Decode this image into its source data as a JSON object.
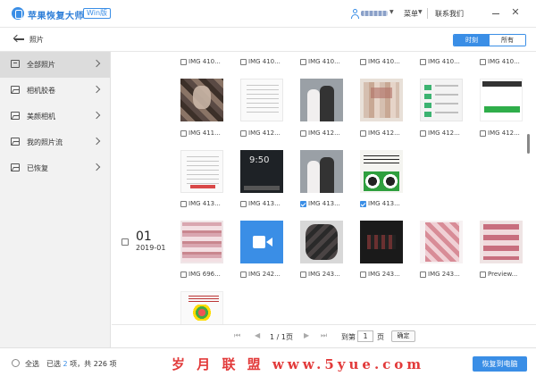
{
  "app": {
    "title": "苹果恢复大师",
    "edition": "Win版",
    "menu_label": "菜单",
    "contact_label": "联系我们",
    "minimize_icon": "minimize-icon",
    "close_icon": "close-icon",
    "accent_color": "#3a8ee6"
  },
  "subheader": {
    "section_title": "照片",
    "tabs": [
      {
        "label": "时刻",
        "active": true
      },
      {
        "label": "所有",
        "active": false
      }
    ]
  },
  "sidebar": {
    "items": [
      {
        "label": "全部照片",
        "active": true
      },
      {
        "label": "相机胶卷",
        "active": false
      },
      {
        "label": "美颜相机",
        "active": false
      },
      {
        "label": "我的照片流",
        "active": false
      },
      {
        "label": "已恢复",
        "active": false
      }
    ]
  },
  "grid": {
    "row0": [
      {
        "name": "IMG 410...",
        "checked": false
      },
      {
        "name": "IMG 410...",
        "checked": false
      },
      {
        "name": "IMG 410...",
        "checked": false
      },
      {
        "name": "IMG 410...",
        "checked": false
      },
      {
        "name": "IMG 410...",
        "checked": false
      },
      {
        "name": "IMG 410...",
        "checked": false
      }
    ],
    "row1": [
      {
        "name": "IMG 411...",
        "checked": false
      },
      {
        "name": "IMG 412...",
        "checked": false
      },
      {
        "name": "IMG 412...",
        "checked": false
      },
      {
        "name": "IMG 412...",
        "checked": false
      },
      {
        "name": "IMG 412...",
        "checked": false
      },
      {
        "name": "IMG 412...",
        "checked": false
      }
    ],
    "row2": [
      {
        "name": "IMG 413...",
        "checked": false
      },
      {
        "name": "IMG 413...",
        "checked": false
      },
      {
        "name": "IMG 413...",
        "checked": true
      },
      {
        "name": "IMG 413...",
        "checked": true
      }
    ],
    "date_group": {
      "day": "01",
      "date": "2019-01"
    },
    "row3": [
      {
        "name": "IMG 696...",
        "checked": false
      },
      {
        "name": "IMG 242...",
        "checked": false
      },
      {
        "name": "IMG 243...",
        "checked": false
      },
      {
        "name": "IMG 243...",
        "checked": false
      },
      {
        "name": "IMG 243...",
        "checked": false
      },
      {
        "name": "Preview...",
        "checked": false
      }
    ]
  },
  "pagination": {
    "current": "1 / 1页",
    "goto_label": "到第",
    "page_value": "1",
    "page_suffix": "页",
    "confirm_label": "确定"
  },
  "footer": {
    "select_all_label": "全选",
    "selected_prefix": "已选 ",
    "selected_count": "2",
    "selected_suffix": " 项，共 226 项",
    "watermark": "岁 月 联 盟  www.5yue.com",
    "recover_button": "恢复到电脑"
  }
}
